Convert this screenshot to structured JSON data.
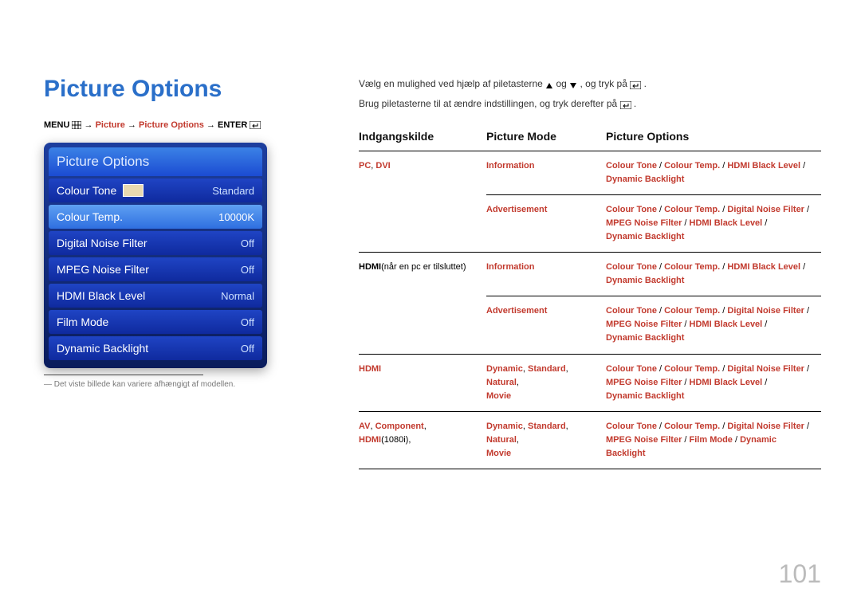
{
  "title": "Picture Options",
  "breadcrumb": {
    "menu": "MENU",
    "arrow": " → ",
    "picture": "Picture",
    "options": "Picture Options",
    "enter": "ENTER"
  },
  "osd": {
    "header": "Picture Options",
    "rows": [
      {
        "label": "Colour Tone",
        "value": "Standard",
        "swatch": true,
        "selected": false
      },
      {
        "label": "Colour Temp.",
        "value": "10000K",
        "swatch": false,
        "selected": true
      },
      {
        "label": "Digital Noise Filter",
        "value": "Off",
        "swatch": false,
        "selected": false
      },
      {
        "label": "MPEG Noise Filter",
        "value": "Off",
        "swatch": false,
        "selected": false
      },
      {
        "label": "HDMI Black Level",
        "value": "Normal",
        "swatch": false,
        "selected": false
      },
      {
        "label": "Film Mode",
        "value": "Off",
        "swatch": false,
        "selected": false
      },
      {
        "label": "Dynamic Backlight",
        "value": "Off",
        "swatch": false,
        "selected": false
      }
    ]
  },
  "footnote": "Det viste billede kan variere afhængigt af modellen.",
  "intro": {
    "line1a": "Vælg en mulighed ved hjælp af piletasterne ",
    "line1b": " og ",
    "line1c": ", og tryk på ",
    "line1d": ".",
    "line2a": "Brug piletasterne til at ændre indstillingen, og tryk derefter på ",
    "line2b": "."
  },
  "table": {
    "headers": {
      "c1": "Indgangskilde",
      "c2": "Picture Mode",
      "c3": "Picture Options"
    },
    "rows": [
      {
        "c1": [
          {
            "t": "PC",
            "cls": "b r"
          },
          {
            "t": ", ",
            "cls": "k"
          },
          {
            "t": "DVI",
            "cls": "b r"
          }
        ],
        "c2": [
          {
            "t": "Information",
            "cls": "b r"
          }
        ],
        "c3": [
          {
            "t": "Colour Tone",
            "cls": "b r"
          },
          {
            "t": " / ",
            "cls": "k"
          },
          {
            "t": "Colour Temp.",
            "cls": "b r"
          },
          {
            "t": " / ",
            "cls": "k"
          },
          {
            "t": "HDMI Black Level",
            "cls": "b r"
          },
          {
            "t": " / ",
            "cls": "k"
          },
          {
            "t": "\n",
            "cls": ""
          },
          {
            "t": "Dynamic Backlight",
            "cls": "b r"
          }
        ]
      },
      {
        "c1": [],
        "c2": [
          {
            "t": "Advertisement",
            "cls": "b r"
          }
        ],
        "c3": [
          {
            "t": "Colour Tone",
            "cls": "b r"
          },
          {
            "t": " / ",
            "cls": "k"
          },
          {
            "t": "Colour Temp.",
            "cls": "b r"
          },
          {
            "t": " / ",
            "cls": "k"
          },
          {
            "t": "Digital Noise Filter",
            "cls": "b r"
          },
          {
            "t": " / ",
            "cls": "k"
          },
          {
            "t": "\n",
            "cls": ""
          },
          {
            "t": "MPEG Noise Filter",
            "cls": "b r"
          },
          {
            "t": " / ",
            "cls": "k"
          },
          {
            "t": "HDMI Black Level",
            "cls": "b r"
          },
          {
            "t": " / ",
            "cls": "k"
          },
          {
            "t": "\n",
            "cls": ""
          },
          {
            "t": "Dynamic Backlight",
            "cls": "b r"
          }
        ]
      },
      {
        "c1": [
          {
            "t": "HDMI",
            "cls": "b k"
          },
          {
            "t": "(når en pc er tilsluttet)",
            "cls": "k"
          }
        ],
        "c2": [
          {
            "t": "Information",
            "cls": "b r"
          }
        ],
        "c3": [
          {
            "t": "Colour Tone",
            "cls": "b r"
          },
          {
            "t": " / ",
            "cls": "k"
          },
          {
            "t": "Colour Temp.",
            "cls": "b r"
          },
          {
            "t": " / ",
            "cls": "k"
          },
          {
            "t": "HDMI Black Level",
            "cls": "b r"
          },
          {
            "t": " / ",
            "cls": "k"
          },
          {
            "t": "\n",
            "cls": ""
          },
          {
            "t": "Dynamic Backlight",
            "cls": "b r"
          }
        ]
      },
      {
        "c1": [],
        "c2": [
          {
            "t": "Advertisement",
            "cls": "b r"
          }
        ],
        "c3": [
          {
            "t": "Colour Tone",
            "cls": "b r"
          },
          {
            "t": " / ",
            "cls": "k"
          },
          {
            "t": "Colour Temp.",
            "cls": "b r"
          },
          {
            "t": " / ",
            "cls": "k"
          },
          {
            "t": "Digital Noise Filter",
            "cls": "b r"
          },
          {
            "t": " / ",
            "cls": "k"
          },
          {
            "t": "\n",
            "cls": ""
          },
          {
            "t": "MPEG Noise Filter",
            "cls": "b r"
          },
          {
            "t": " / ",
            "cls": "k"
          },
          {
            "t": "HDMI Black Level",
            "cls": "b r"
          },
          {
            "t": " / ",
            "cls": "k"
          },
          {
            "t": "\n",
            "cls": ""
          },
          {
            "t": "Dynamic Backlight",
            "cls": "b r"
          }
        ]
      },
      {
        "c1": [
          {
            "t": "HDMI",
            "cls": "b r"
          }
        ],
        "c2": [
          {
            "t": "Dynamic",
            "cls": "b r"
          },
          {
            "t": ", ",
            "cls": "k"
          },
          {
            "t": "Standard",
            "cls": "b r"
          },
          {
            "t": ", ",
            "cls": "k"
          },
          {
            "t": "Natural",
            "cls": "b r"
          },
          {
            "t": ", ",
            "cls": "k"
          },
          {
            "t": "\n",
            "cls": ""
          },
          {
            "t": "Movie",
            "cls": "b r"
          }
        ],
        "c3": [
          {
            "t": "Colour Tone",
            "cls": "b r"
          },
          {
            "t": " / ",
            "cls": "k"
          },
          {
            "t": "Colour Temp.",
            "cls": "b r"
          },
          {
            "t": " / ",
            "cls": "k"
          },
          {
            "t": "Digital Noise Filter",
            "cls": "b r"
          },
          {
            "t": " / ",
            "cls": "k"
          },
          {
            "t": "\n",
            "cls": ""
          },
          {
            "t": "MPEG Noise Filter",
            "cls": "b r"
          },
          {
            "t": " / ",
            "cls": "k"
          },
          {
            "t": "HDMI Black Level",
            "cls": "b r"
          },
          {
            "t": " / ",
            "cls": "k"
          },
          {
            "t": "\n",
            "cls": ""
          },
          {
            "t": "Dynamic Backlight",
            "cls": "b r"
          }
        ]
      },
      {
        "c1": [
          {
            "t": "AV",
            "cls": "b r"
          },
          {
            "t": ", ",
            "cls": "k"
          },
          {
            "t": "Component",
            "cls": "b r"
          },
          {
            "t": ", ",
            "cls": "k"
          },
          {
            "t": "HDMI",
            "cls": "b r"
          },
          {
            "t": "(1080i)",
            "cls": "k"
          },
          {
            "t": ",",
            "cls": "k"
          }
        ],
        "c2": [
          {
            "t": "Dynamic",
            "cls": "b r"
          },
          {
            "t": ", ",
            "cls": "k"
          },
          {
            "t": "Standard",
            "cls": "b r"
          },
          {
            "t": ", ",
            "cls": "k"
          },
          {
            "t": "Natural",
            "cls": "b r"
          },
          {
            "t": ", ",
            "cls": "k"
          },
          {
            "t": "\n",
            "cls": ""
          },
          {
            "t": "Movie",
            "cls": "b r"
          }
        ],
        "c3": [
          {
            "t": "Colour Tone",
            "cls": "b r"
          },
          {
            "t": " / ",
            "cls": "k"
          },
          {
            "t": "Colour Temp.",
            "cls": "b r"
          },
          {
            "t": " / ",
            "cls": "k"
          },
          {
            "t": "Digital Noise Filter",
            "cls": "b r"
          },
          {
            "t": " / ",
            "cls": "k"
          },
          {
            "t": "\n",
            "cls": ""
          },
          {
            "t": "MPEG Noise Filter",
            "cls": "b r"
          },
          {
            "t": " / ",
            "cls": "k"
          },
          {
            "t": "Film Mode",
            "cls": "b r"
          },
          {
            "t": " / ",
            "cls": "k"
          },
          {
            "t": "Dynamic Backlight",
            "cls": "b r"
          }
        ]
      }
    ]
  },
  "pageNumber": "101"
}
